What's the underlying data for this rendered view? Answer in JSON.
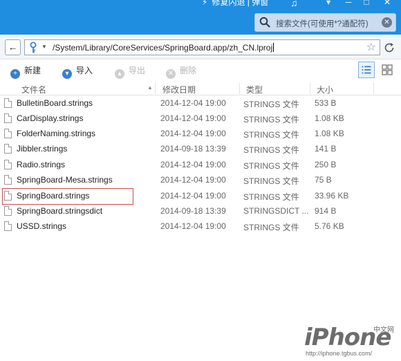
{
  "titlebar": {
    "link_text": "修复闪退 | 弹窗",
    "minimize": "─",
    "maximize": "□",
    "close": "✕"
  },
  "search": {
    "placeholder": "搜索文件(可使用*?通配符)"
  },
  "address": {
    "path": "/System/Library/CoreServices/SpringBoard.app/zh_CN.lproj"
  },
  "toolbar": {
    "new_label": "新建",
    "import_label": "导入",
    "export_label": "导出",
    "delete_label": "删除"
  },
  "columns": {
    "name": "文件名",
    "date": "修改日期",
    "type": "类型",
    "size": "大小"
  },
  "files": [
    {
      "name": "BulletinBoard.strings",
      "date": "2014-12-04 19:00",
      "type": "STRINGS 文件",
      "size": "533 B"
    },
    {
      "name": "CarDisplay.strings",
      "date": "2014-12-04 19:00",
      "type": "STRINGS 文件",
      "size": "1.08 KB"
    },
    {
      "name": "FolderNaming.strings",
      "date": "2014-12-04 19:00",
      "type": "STRINGS 文件",
      "size": "1.08 KB"
    },
    {
      "name": "Jibbler.strings",
      "date": "2014-09-18 13:39",
      "type": "STRINGS 文件",
      "size": "141 B"
    },
    {
      "name": "Radio.strings",
      "date": "2014-12-04 19:00",
      "type": "STRINGS 文件",
      "size": "250 B"
    },
    {
      "name": "SpringBoard-Mesa.strings",
      "date": "2014-12-04 19:00",
      "type": "STRINGS 文件",
      "size": "75 B"
    },
    {
      "name": "SpringBoard.strings",
      "date": "2014-12-04 19:00",
      "type": "STRINGS 文件",
      "size": "33.96 KB"
    },
    {
      "name": "SpringBoard.stringsdict",
      "date": "2014-09-18 13:39",
      "type": "STRINGSDICT ...",
      "size": "914 B"
    },
    {
      "name": "USSD.strings",
      "date": "2014-12-04 19:00",
      "type": "STRINGS 文件",
      "size": "5.76 KB"
    }
  ],
  "watermark": {
    "logo": "iPhone",
    "zh": "中文网",
    "url": "http://iphone.tgbus.com/"
  },
  "colors": {
    "titlebar": "#1f8ee0",
    "accent": "#3b7fcf",
    "selection_border": "#c84a4a"
  }
}
